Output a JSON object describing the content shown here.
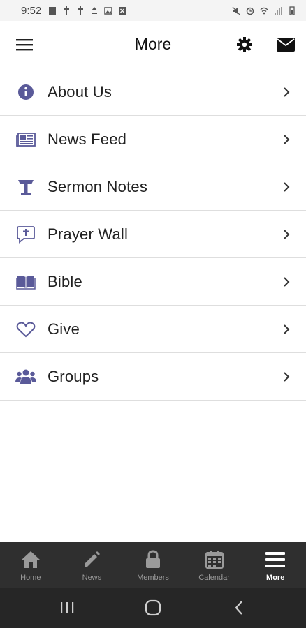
{
  "status_bar": {
    "time": "9:52"
  },
  "header": {
    "title": "More",
    "menu_icon": "hamburger-icon",
    "settings_icon": "gear-icon",
    "mail_icon": "envelope-icon"
  },
  "menu_items": [
    {
      "label": "About Us",
      "icon": "info-icon"
    },
    {
      "label": "News Feed",
      "icon": "newspaper-icon"
    },
    {
      "label": "Sermon Notes",
      "icon": "podium-icon"
    },
    {
      "label": "Prayer Wall",
      "icon": "prayer-chat-icon"
    },
    {
      "label": "Bible",
      "icon": "open-book-icon"
    },
    {
      "label": "Give",
      "icon": "heart-icon"
    },
    {
      "label": "Groups",
      "icon": "users-icon"
    }
  ],
  "bottom_nav": {
    "tabs": [
      {
        "label": "Home",
        "icon": "home-icon"
      },
      {
        "label": "News",
        "icon": "pencil-icon"
      },
      {
        "label": "Members",
        "icon": "lock-icon"
      },
      {
        "label": "Calendar",
        "icon": "calendar-icon"
      },
      {
        "label": "More",
        "icon": "menu-icon",
        "active": true
      }
    ]
  },
  "colors": {
    "accent_icon": "#5a5a99",
    "nav_bg": "#2f2f2f",
    "system_nav_bg": "#262626"
  }
}
